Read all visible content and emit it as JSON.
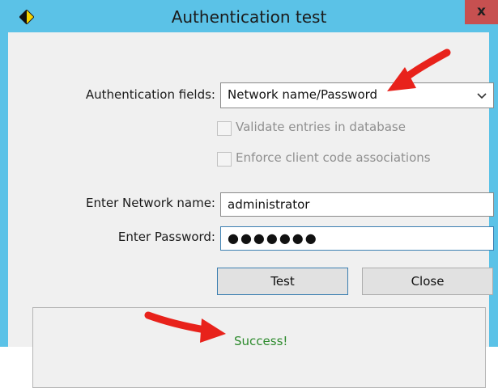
{
  "window": {
    "title": "Authentication test",
    "close_glyph": "x"
  },
  "form": {
    "auth_fields_label": "Authentication fields:",
    "auth_fields_value": "Network name/Password",
    "validate_label": "Validate entries in database",
    "validate_checked": false,
    "enforce_label": "Enforce client code associations",
    "enforce_checked": false,
    "network_name_label": "Enter Network name:",
    "network_name_value": "administrator",
    "password_label": "Enter Password:",
    "password_value": "●●●●●●●"
  },
  "buttons": {
    "test_label": "Test",
    "close_label": "Close"
  },
  "result": {
    "message": "Success!"
  },
  "colors": {
    "titlebar": "#5bc2e7",
    "close_button": "#c75050",
    "success_text": "#2e8b2e",
    "annotation_arrow": "#e8221b"
  },
  "icons": {
    "app": "diamond-app-icon",
    "dropdown": "chevron-down-icon"
  }
}
